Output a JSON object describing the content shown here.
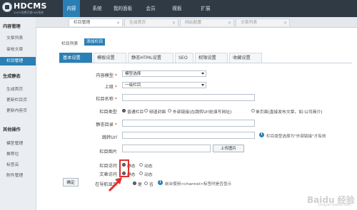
{
  "header": {
    "logo_text": "HDCMS",
    "logo_sub": "100%免费开源CMS系统",
    "nav": [
      "内容",
      "系统",
      "我的面板",
      "会员",
      "模板",
      "扩展"
    ]
  },
  "sidebar": {
    "groups": [
      {
        "title": "内容管理",
        "items": [
          "文章列表",
          "审核文章",
          "栏目管理"
        ]
      },
      {
        "title": "生成静态",
        "items": [
          "生成首页",
          "更新栏目页",
          "更新内容页"
        ]
      },
      {
        "title": "其他操作",
        "items": [
          "模型管理",
          "推荐位",
          "标签云",
          "附件管理"
        ]
      }
    ]
  },
  "window_tabs": [
    "栏目管理",
    "生成首页",
    "网站配置",
    "文章列表"
  ],
  "content": {
    "list_link": "栏目列表",
    "add_button": "添加栏目",
    "tabs": [
      "基本设置",
      "模板设置",
      "静态HTML设置",
      "SEO",
      "权限设置",
      "收藏设置"
    ],
    "form": {
      "model_label": "内容模型",
      "model_value": "模型选择",
      "parent_label": "上级",
      "parent_value": "一级栏目",
      "name_label": "栏目名称",
      "type_label": "栏目类型",
      "type_options": [
        "普通栏目",
        "频道封面",
        "外部链接(在跳转Url处填写网址)",
        "单页面(直接发布文章，如:公司简介)"
      ],
      "dir_label": "静态目录",
      "url_label": "跳转Url",
      "url_hint": "栏目类型选择为\"外部链接\"才有效",
      "image_label": "栏目图片",
      "upload_button": "上传图片",
      "visit_label": "栏目访问",
      "article_label": "文章访问",
      "nav_label": "在导航显示",
      "static_option": "静态",
      "dynamic_option": "动态",
      "yes_option": "是",
      "no_option": "否",
      "nav_hint": "前台使用<channel>标签时是否显示",
      "required_mark": "*",
      "ok_button": "确定"
    }
  },
  "watermark": {
    "text": "Baidu 经验",
    "sub": "jingyan.baidu.com"
  },
  "colors": {
    "topbar": "#2f3a45",
    "accent": "#2a7fb4",
    "sidebar": "#eaeef2",
    "highlight": "#e03030"
  }
}
